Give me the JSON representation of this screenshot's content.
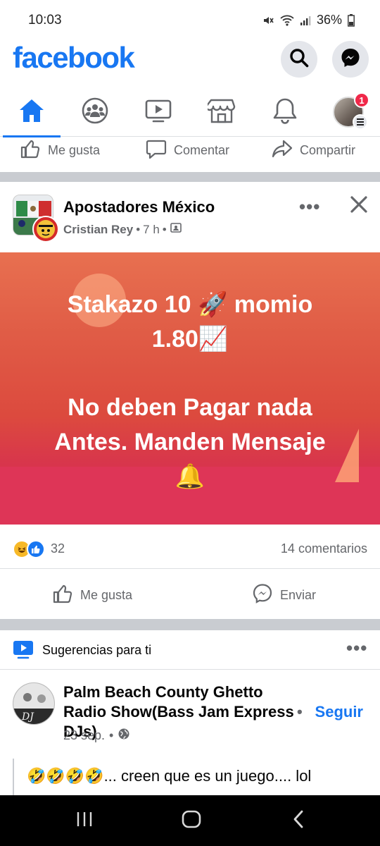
{
  "status_bar": {
    "time": "10:03",
    "battery": "36%"
  },
  "header": {
    "logo": "facebook",
    "icons": [
      "search-icon",
      "messenger-icon"
    ]
  },
  "tabs": [
    {
      "icon": "home-icon",
      "active": true
    },
    {
      "icon": "groups-icon",
      "active": false
    },
    {
      "icon": "watch-icon",
      "active": false
    },
    {
      "icon": "marketplace-icon",
      "active": false
    },
    {
      "icon": "bell-icon",
      "active": false
    },
    {
      "icon": "profile-menu",
      "active": false,
      "badge": "1"
    }
  ],
  "prev_post_actions": {
    "like": "Me gusta",
    "comment": "Comentar",
    "share": "Compartir"
  },
  "post": {
    "page_name": "Apostadores México",
    "author": "Cristian Rey",
    "time": "7 h",
    "dot": "•",
    "more": "•••",
    "body_lines": [
      "Stakazo 10 🚀 momio",
      "1.80📈",
      "",
      "No deben Pagar nada",
      "Antes. Manden Mensaje",
      "🔔"
    ],
    "reaction_count": "32",
    "comment_count": "14 comentarios",
    "like_label": "Me gusta",
    "send_label": "Enviar",
    "colors": {
      "bg_top": "#e87050",
      "bg_bottom": "#de3557"
    }
  },
  "suggestions": {
    "label": "Sugerencias para ti",
    "more": "•••",
    "post": {
      "page_name": "Palm Beach County Ghetto Radio Show(Bass Jam Express DJs)",
      "dot": "•",
      "follow_label": "Seguir",
      "date": "23 sep.",
      "text": "🤣🤣🤣🤣... creen que es un juego.... lol"
    }
  },
  "nav_bar": {
    "buttons": [
      "recent-apps-icon",
      "home-button-icon",
      "back-icon"
    ]
  },
  "brand_color": "#1877f2"
}
